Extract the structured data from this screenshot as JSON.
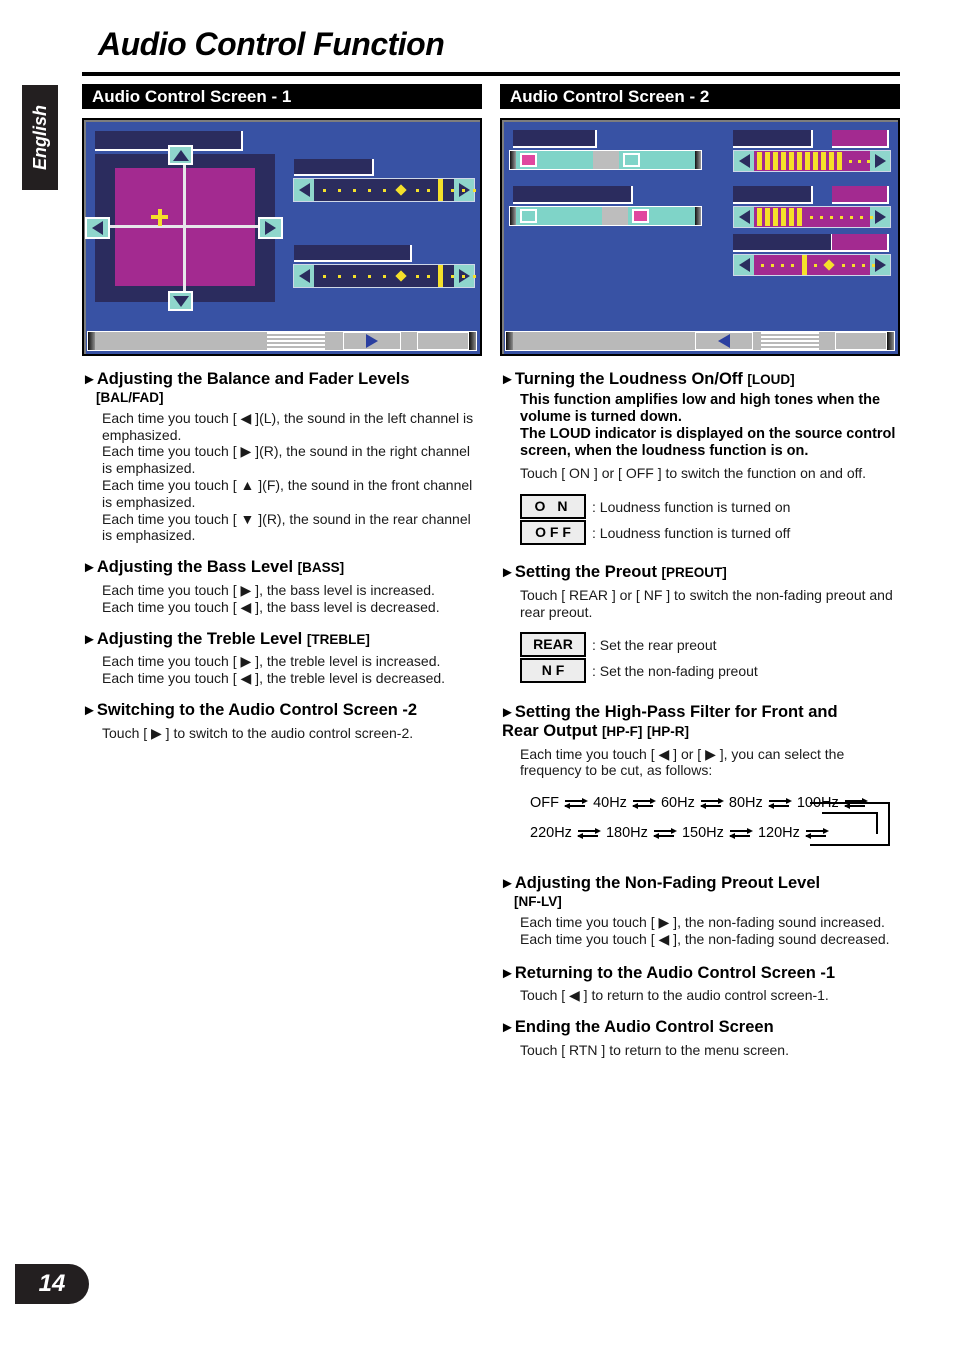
{
  "language_tab": "English",
  "page_number": "14",
  "title": "Audio Control Function",
  "left": {
    "section_bar": "Audio Control Screen - 1",
    "sections": [
      {
        "heading": "Adjusting the Balance and Fader Levels",
        "code": "",
        "sub_code": "[BAL/FAD]",
        "body": "Each time you touch [ ◀ ](L), the sound in the left channel is emphasized.\nEach time you touch [ ▶ ](R), the sound in the right channel is emphasized.\nEach time you touch [ ▲ ](F), the sound in the front channel is emphasized.\nEach time you touch [ ▼ ](R), the sound in the rear channel is emphasized."
      },
      {
        "heading": "Adjusting the Bass Level",
        "code": "[BASS]",
        "sub_code": "",
        "body": "Each time you touch [ ▶ ], the bass level is increased.\nEach time you touch [ ◀ ], the bass level is decreased."
      },
      {
        "heading": "Adjusting the Treble Level",
        "code": "[TREBLE]",
        "sub_code": "",
        "body": "Each time you touch [ ▶ ], the treble level is increased.\nEach time you touch [ ◀ ], the treble level is decreased."
      },
      {
        "heading": "Switching to the Audio Control Screen -2",
        "code": "",
        "sub_code": "",
        "body": "Touch [ ▶ ] to switch to the audio control screen-2."
      }
    ]
  },
  "right": {
    "section_bar": "Audio Control Screen - 2",
    "loudness": {
      "heading": "Turning the Loudness On/Off",
      "code": "[LOUD]",
      "note": "This function amplifies low and high tones when the volume is turned down.\nThe LOUD indicator is displayed on the source control screen, when the loudness function is on.",
      "body": "Touch [ ON ] or [ OFF ] to switch the function on and off.",
      "keys": [
        {
          "label": "O N",
          "desc": ": Loudness function is turned on"
        },
        {
          "label": "O F F",
          "desc": ": Loudness function is turned off"
        }
      ]
    },
    "preout": {
      "heading": "Setting the Preout",
      "code": "[PREOUT]",
      "body": "Touch [ REAR ] or [ NF ] to switch the non-fading preout and rear preout.",
      "keys": [
        {
          "label": "REAR",
          "desc": ": Set the rear preout"
        },
        {
          "label": "N F",
          "desc": ": Set the non-fading preout"
        }
      ]
    },
    "hpf": {
      "heading_line1": "Setting the High-Pass Filter for Front and",
      "heading_line2": "Rear Output",
      "code1": "[HP-F]",
      "code2": "[HP-R]",
      "body": "Each time you touch [ ◀ ] or [ ▶ ], you can select the frequency to be cut, as follows:",
      "chain_row1": [
        "OFF",
        "40Hz",
        "60Hz",
        "80Hz",
        "100Hz"
      ],
      "chain_row2": [
        "220Hz",
        "180Hz",
        "150Hz",
        "120Hz"
      ]
    },
    "nflv": {
      "heading": "Adjusting the Non-Fading Preout Level",
      "sub_code": "[NF-LV]",
      "body": "Each time you touch [ ▶ ], the non-fading sound increased.\nEach time you touch [ ◀ ], the non-fading sound decreased."
    },
    "returning": {
      "heading": "Returning to the Audio Control Screen -1",
      "body": "Touch [ ◀ ] to return to the audio control screen-1."
    },
    "ending": {
      "heading": "Ending the Audio Control Screen",
      "body": "Touch [ RTN ] to return to the menu screen."
    }
  },
  "colors": {
    "screen_bg": "#3852a4",
    "plate": "#2b2c5e",
    "magenta": "#a32a90",
    "teal": "#8fd6cc",
    "yellow": "#f5e02a",
    "devbar": "#b9b9b9"
  }
}
